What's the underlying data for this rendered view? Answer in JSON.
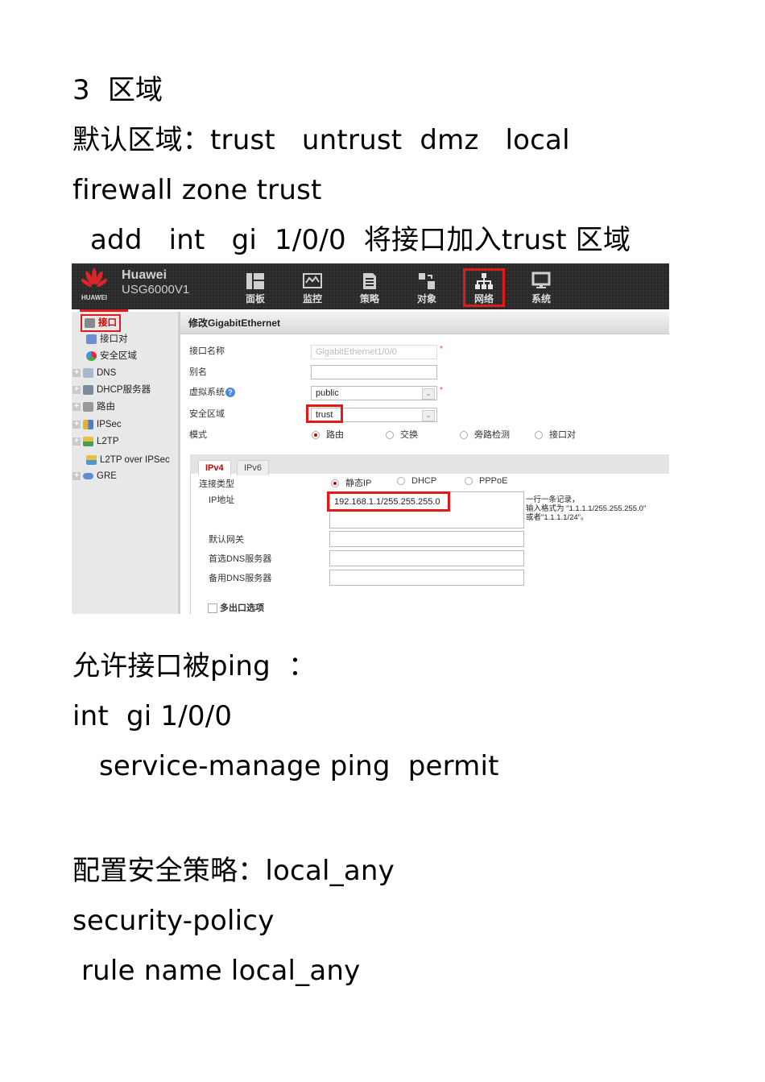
{
  "doc": {
    "lines": [
      "3  区域",
      "默认区域：trust   untrust  dmz   local",
      "firewall zone trust",
      "  add   int   gi  1/0/0  将接口加入trust 区域",
      "允许接口被ping  ：",
      "int  gi 1/0/0",
      "   service-manage ping  permit",
      "配置安全策略：local_any",
      "security-policy",
      " rule name local_any"
    ]
  },
  "screenshot": {
    "brand": {
      "logo_text": "HUAWEI",
      "name": "Huawei",
      "model": "USG6000V1"
    },
    "nav": [
      {
        "label": "面板",
        "icon": "dashboard-icon"
      },
      {
        "label": "监控",
        "icon": "monitor-icon"
      },
      {
        "label": "策略",
        "icon": "policy-icon"
      },
      {
        "label": "对象",
        "icon": "object-icon"
      },
      {
        "label": "网络",
        "icon": "network-icon",
        "active": true
      },
      {
        "label": "系统",
        "icon": "system-icon"
      }
    ],
    "sidebar": [
      {
        "label": "接口",
        "selected": true,
        "expandable": false
      },
      {
        "label": "接口对",
        "expandable": false
      },
      {
        "label": "安全区域",
        "expandable": false
      },
      {
        "label": "DNS",
        "expandable": true
      },
      {
        "label": "DHCP服务器",
        "expandable": true
      },
      {
        "label": "路由",
        "expandable": true
      },
      {
        "label": "IPSec",
        "expandable": true
      },
      {
        "label": "L2TP",
        "expandable": true
      },
      {
        "label": "L2TP over IPSec",
        "expandable": false
      },
      {
        "label": "GRE",
        "expandable": true
      }
    ],
    "panel_title": "修改GigabitEthernet",
    "form": {
      "interface_name": {
        "label": "接口名称",
        "value": "GigabitEthernet1/0/0",
        "required": "*"
      },
      "alias": {
        "label": "别名",
        "value": ""
      },
      "vsys": {
        "label": "虚拟系统",
        "value": "public",
        "required": "*",
        "help": "?"
      },
      "zone": {
        "label": "安全区域",
        "value": "trust"
      },
      "mode": {
        "label": "模式",
        "options": [
          "路由",
          "交换",
          "旁路检测",
          "接口对"
        ],
        "selected": "路由"
      }
    },
    "tabs": [
      "IPv4",
      "IPv6"
    ],
    "active_tab": "IPv4",
    "ipv4": {
      "conn_type": {
        "label": "连接类型",
        "options": [
          "静态IP",
          "DHCP",
          "PPPoE"
        ],
        "selected": "静态IP"
      },
      "ip": {
        "label": "IP地址",
        "value": "192.168.1.1/255.255.255.0"
      },
      "hint": "一行一条记录，\n输入格式为 \"1.1.1.1/255.255.255.0\"\n或者\"1.1.1.1/24\"。",
      "gateway": {
        "label": "默认网关",
        "value": ""
      },
      "dns1": {
        "label": "首选DNS服务器",
        "value": ""
      },
      "dns2": {
        "label": "备用DNS服务器",
        "value": ""
      },
      "multi_exit": {
        "label": "多出口选项",
        "checked": false
      }
    }
  }
}
